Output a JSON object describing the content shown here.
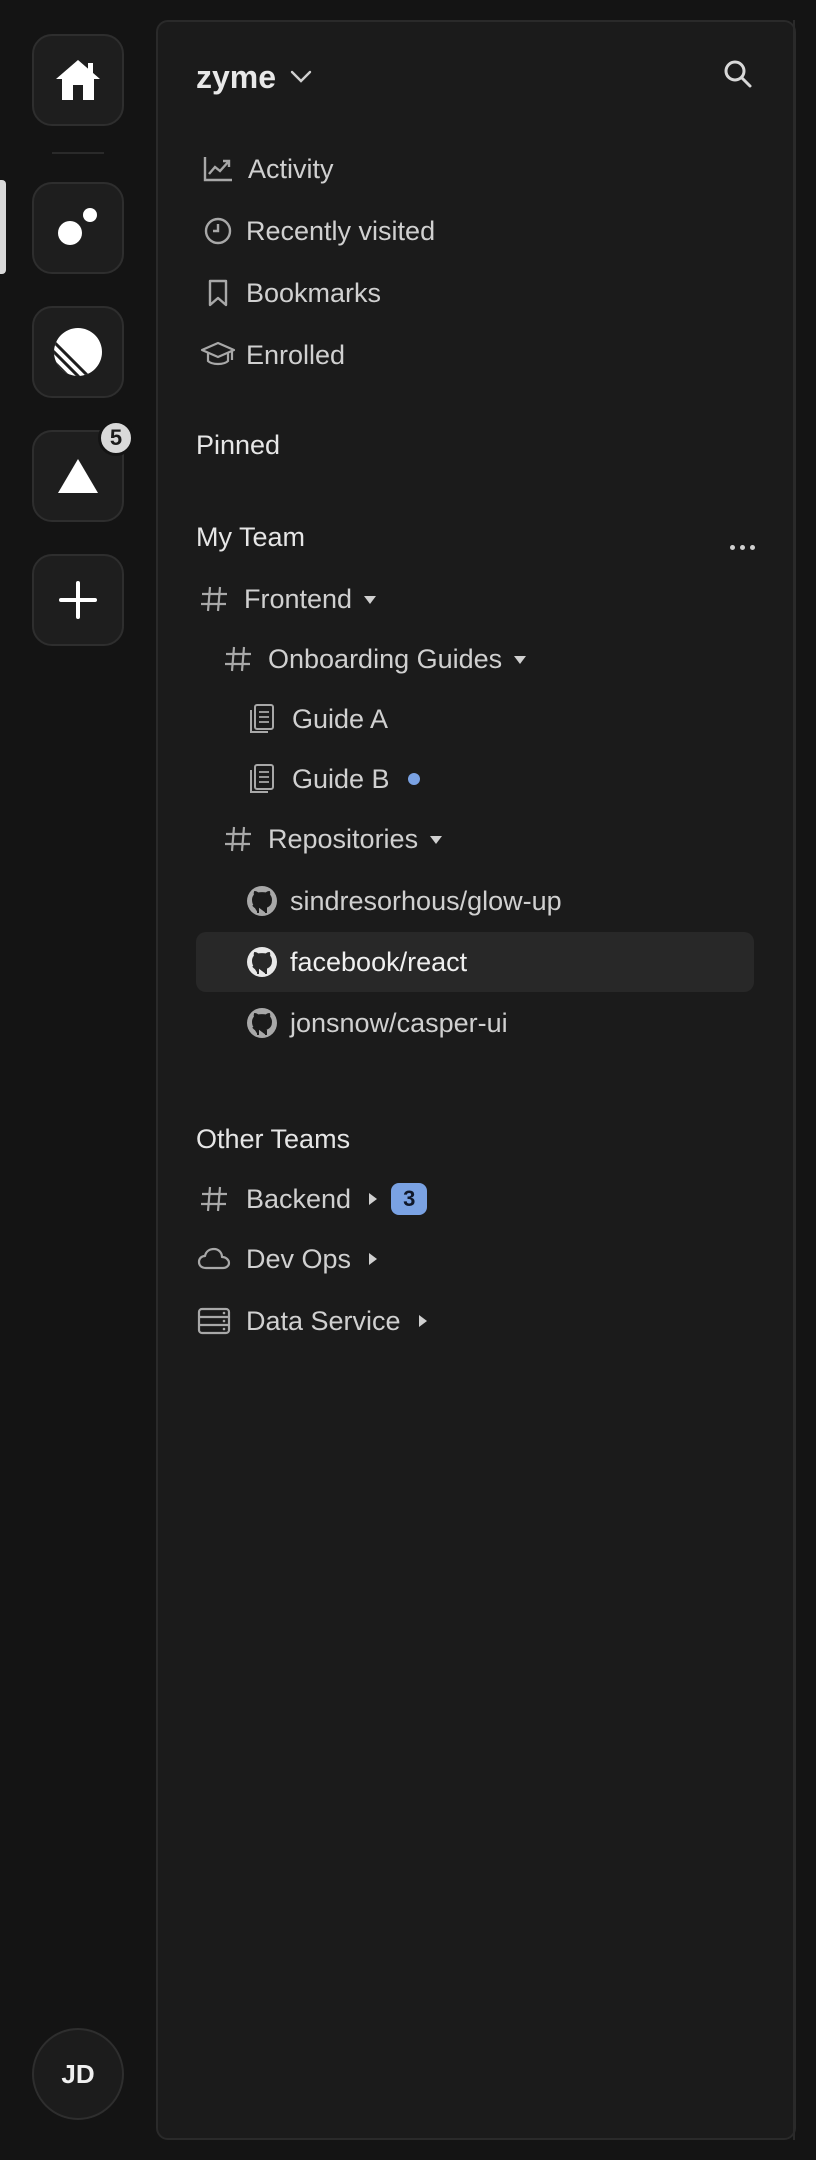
{
  "rail": {
    "items": [
      {
        "name": "home",
        "icon": "home-icon"
      },
      {
        "name": "app-dots",
        "icon": "dots-logo-icon"
      },
      {
        "name": "app-linear",
        "icon": "linear-logo-icon"
      },
      {
        "name": "app-triangle",
        "icon": "triangle-logo-icon",
        "badge": "5"
      },
      {
        "name": "add",
        "icon": "plus-icon"
      }
    ],
    "avatar_initials": "JD"
  },
  "header": {
    "workspace": "zyme"
  },
  "nav": {
    "items": [
      {
        "label": "Activity",
        "icon": "chart-line-icon"
      },
      {
        "label": "Recently visited",
        "icon": "clock-icon"
      },
      {
        "label": "Bookmarks",
        "icon": "bookmark-icon"
      },
      {
        "label": "Enrolled",
        "icon": "graduation-cap-icon"
      }
    ]
  },
  "sections": {
    "pinned": "Pinned",
    "my_team": "My Team",
    "other_teams": "Other Teams"
  },
  "my_team": {
    "frontend": "Frontend",
    "onboarding_guides": "Onboarding Guides",
    "guide_a": "Guide A",
    "guide_b": "Guide B",
    "repositories": "Repositories",
    "repos": [
      "sindresorhous/glow-up",
      "facebook/react",
      "jonsnow/casper-ui"
    ],
    "selected_repo": "facebook/react"
  },
  "other_teams": {
    "backend": "Backend",
    "backend_count": "3",
    "dev_ops": "Dev Ops",
    "data_service": "Data Service"
  },
  "colors": {
    "background": "#141414",
    "panel": "#1b1b1b",
    "accent": "#7aa2e3",
    "selected_row": "#282828"
  }
}
